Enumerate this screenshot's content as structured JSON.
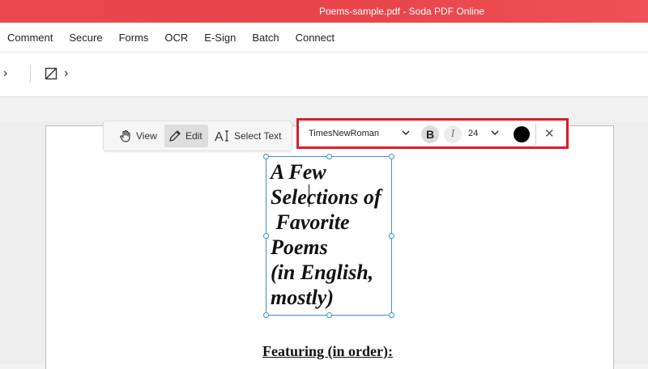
{
  "window": {
    "title": "Poems-sample.pdf - Soda PDF Online"
  },
  "menu": {
    "items": [
      "Comment",
      "Secure",
      "Forms",
      "OCR",
      "E-Sign",
      "Batch",
      "Connect"
    ]
  },
  "mode_bar": {
    "view_label": "View",
    "edit_label": "Edit",
    "select_text_label": "Select Text",
    "active": "Edit"
  },
  "font_toolbar": {
    "font_name": "TimesNewRoman",
    "bold_label": "B",
    "italic_label": "I",
    "font_size": "24",
    "text_color": "#000000",
    "close_label": "✕"
  },
  "document": {
    "title_text": "A Few\nSelections of\n Favorite\nPoems\n(in English,\nmostly)",
    "featuring_heading": "Featuring (in order):"
  },
  "colors": {
    "brand_red": "#e8474c",
    "highlight_border": "#d6202a",
    "selection_blue": "#3a8fd0"
  }
}
